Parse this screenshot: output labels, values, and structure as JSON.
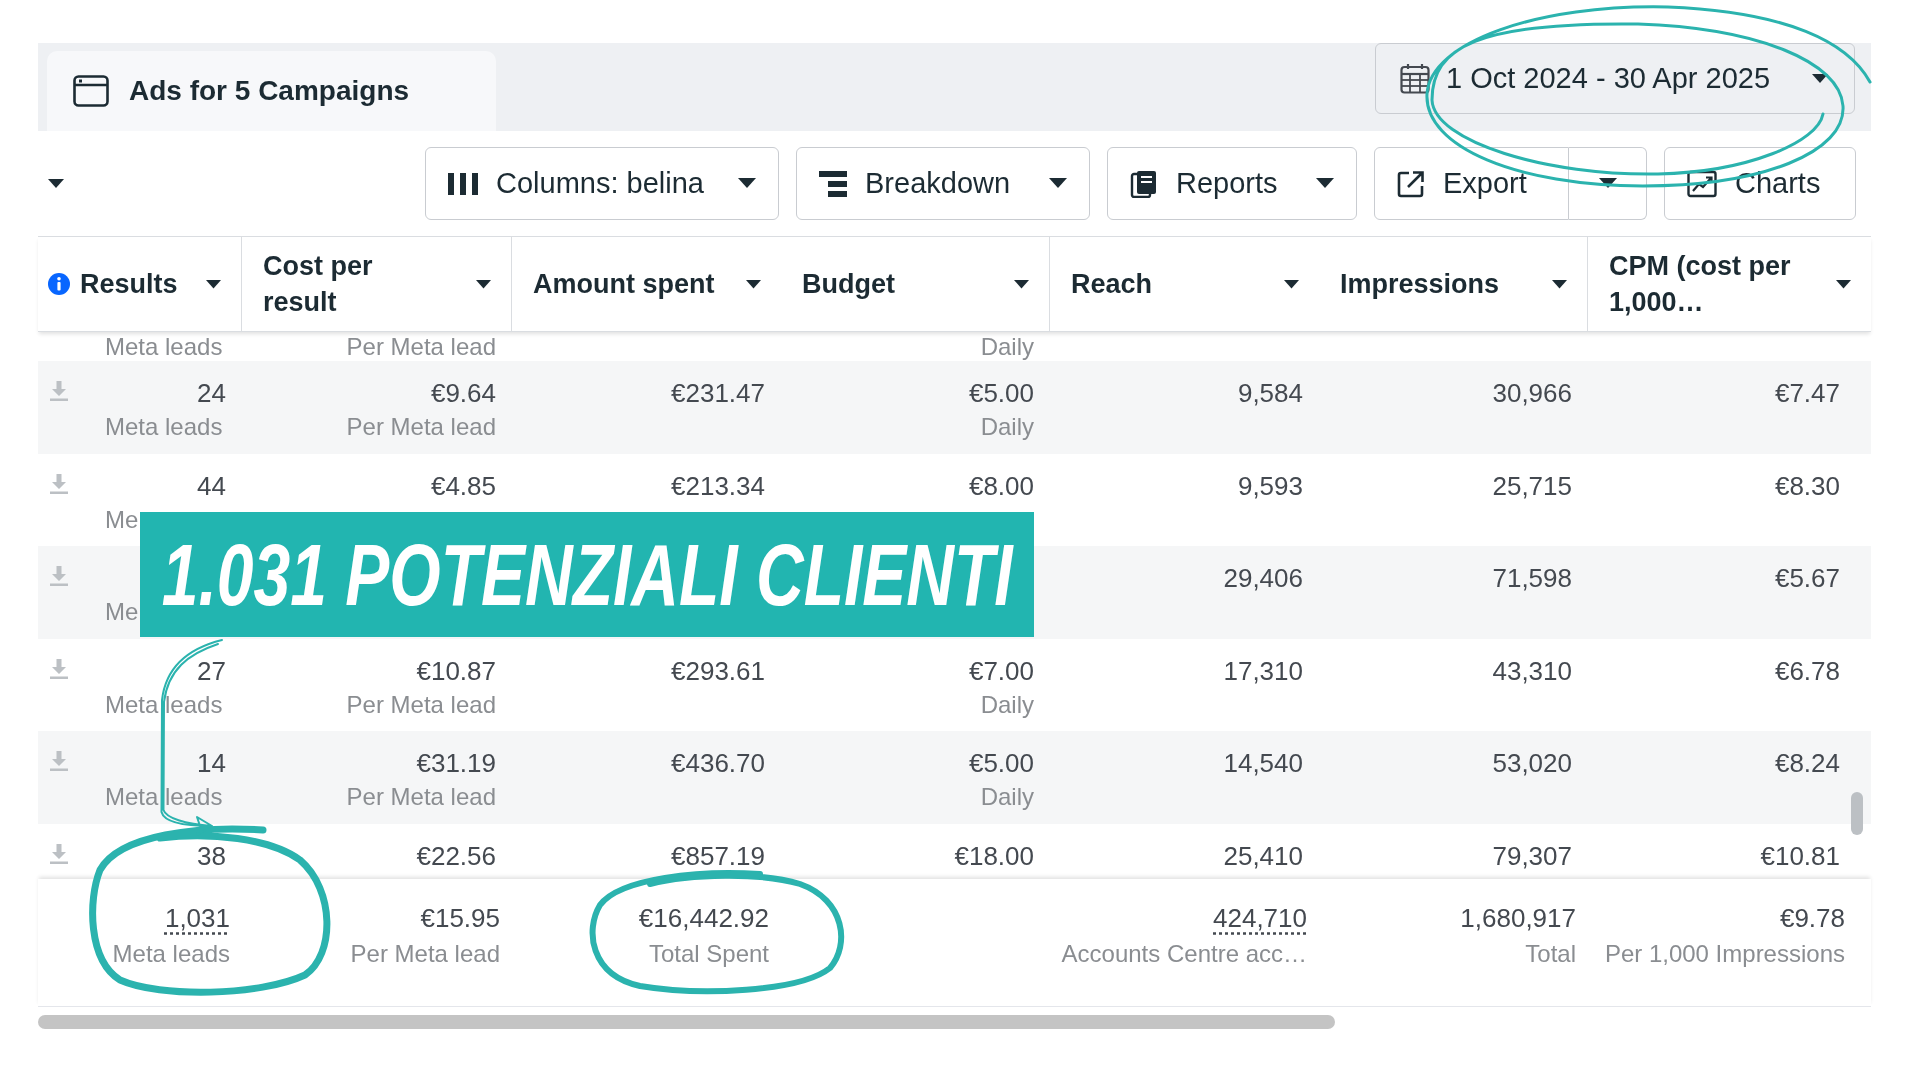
{
  "tab": {
    "title": "Ads for 5 Campaigns"
  },
  "date_range": {
    "label": "1 Oct 2024 - 30 Apr 2025"
  },
  "toolbar": {
    "buttons": [
      {
        "kind": "dropdown",
        "label": "Columns: belina"
      },
      {
        "kind": "dropdown",
        "label": "Breakdown"
      },
      {
        "kind": "dropdown",
        "label": "Reports"
      },
      {
        "kind": "split",
        "label": "Export"
      },
      {
        "kind": "plain",
        "label": "Charts"
      }
    ]
  },
  "table": {
    "columns": [
      "Results",
      "Cost per result",
      "Amount spent",
      "Budget",
      "Reach",
      "Impressions",
      "CPM (cost per 1,000…"
    ],
    "rows": [
      {
        "kind": "partial",
        "cells": {
          "results": {
            "caption": "Meta leads"
          },
          "cost_per_result": {
            "caption": "Per Meta lead"
          },
          "budget": {
            "caption": "Daily"
          }
        }
      },
      {
        "kind": "full",
        "cells": {
          "results": {
            "value": "24",
            "caption": "Meta leads"
          },
          "cost_per_result": {
            "value": "€9.64",
            "caption": "Per Meta lead"
          },
          "amount_spent": {
            "value": "€231.47"
          },
          "budget": {
            "value": "€5.00",
            "caption": "Daily"
          },
          "reach": {
            "value": "9,584"
          },
          "impressions": {
            "value": "30,966"
          },
          "cpm": {
            "value": "€7.47"
          }
        }
      },
      {
        "kind": "full",
        "cells": {
          "results": {
            "value": "44",
            "caption": "Me"
          },
          "cost_per_result": {
            "value": "€4.85"
          },
          "amount_spent": {
            "value": "€213.34"
          },
          "budget": {
            "value": "€8.00"
          },
          "reach": {
            "value": "9,593"
          },
          "impressions": {
            "value": "25,715"
          },
          "cpm": {
            "value": "€8.30"
          }
        }
      },
      {
        "kind": "full",
        "cells": {
          "results": {
            "caption": "Me"
          },
          "reach": {
            "value": "29,406"
          },
          "impressions": {
            "value": "71,598"
          },
          "cpm": {
            "value": "€5.67"
          }
        }
      },
      {
        "kind": "full",
        "cells": {
          "results": {
            "value": "27",
            "caption": "Meta leads"
          },
          "cost_per_result": {
            "value": "€10.87",
            "caption": "Per Meta lead"
          },
          "amount_spent": {
            "value": "€293.61"
          },
          "budget": {
            "value": "€7.00",
            "caption": "Daily"
          },
          "reach": {
            "value": "17,310"
          },
          "impressions": {
            "value": "43,310"
          },
          "cpm": {
            "value": "€6.78"
          }
        }
      },
      {
        "kind": "full",
        "cells": {
          "results": {
            "value": "14",
            "caption": "Meta leads"
          },
          "cost_per_result": {
            "value": "€31.19",
            "caption": "Per Meta lead"
          },
          "amount_spent": {
            "value": "€436.70"
          },
          "budget": {
            "value": "€5.00",
            "caption": "Daily"
          },
          "reach": {
            "value": "14,540"
          },
          "impressions": {
            "value": "53,020"
          },
          "cpm": {
            "value": "€8.24"
          }
        }
      },
      {
        "kind": "full",
        "cells": {
          "results": {
            "value": "38"
          },
          "cost_per_result": {
            "value": "€22.56"
          },
          "amount_spent": {
            "value": "€857.19"
          },
          "budget": {
            "value": "€18.00"
          },
          "reach": {
            "value": "25,410"
          },
          "impressions": {
            "value": "79,307"
          },
          "cpm": {
            "value": "€10.81"
          }
        }
      }
    ],
    "totals": {
      "results": {
        "value": "1,031",
        "caption": "Meta leads",
        "underlined": true
      },
      "cost_per_result": {
        "value": "€15.95",
        "caption": "Per Meta lead",
        "underlined": false
      },
      "amount_spent": {
        "value": "€16,442.92",
        "caption": "Total Spent",
        "underlined": false
      },
      "reach": {
        "value": "424,710",
        "caption": "Accounts Centre acc…",
        "underlined": true
      },
      "impressions": {
        "value": "1,680,917",
        "caption": "Total",
        "underlined": false
      },
      "cpm": {
        "value": "€9.78",
        "caption": "Per 1,000 Impressions",
        "underlined": false
      }
    }
  },
  "banner": {
    "text": "1.031 POTENZIALI CLIENTI"
  }
}
